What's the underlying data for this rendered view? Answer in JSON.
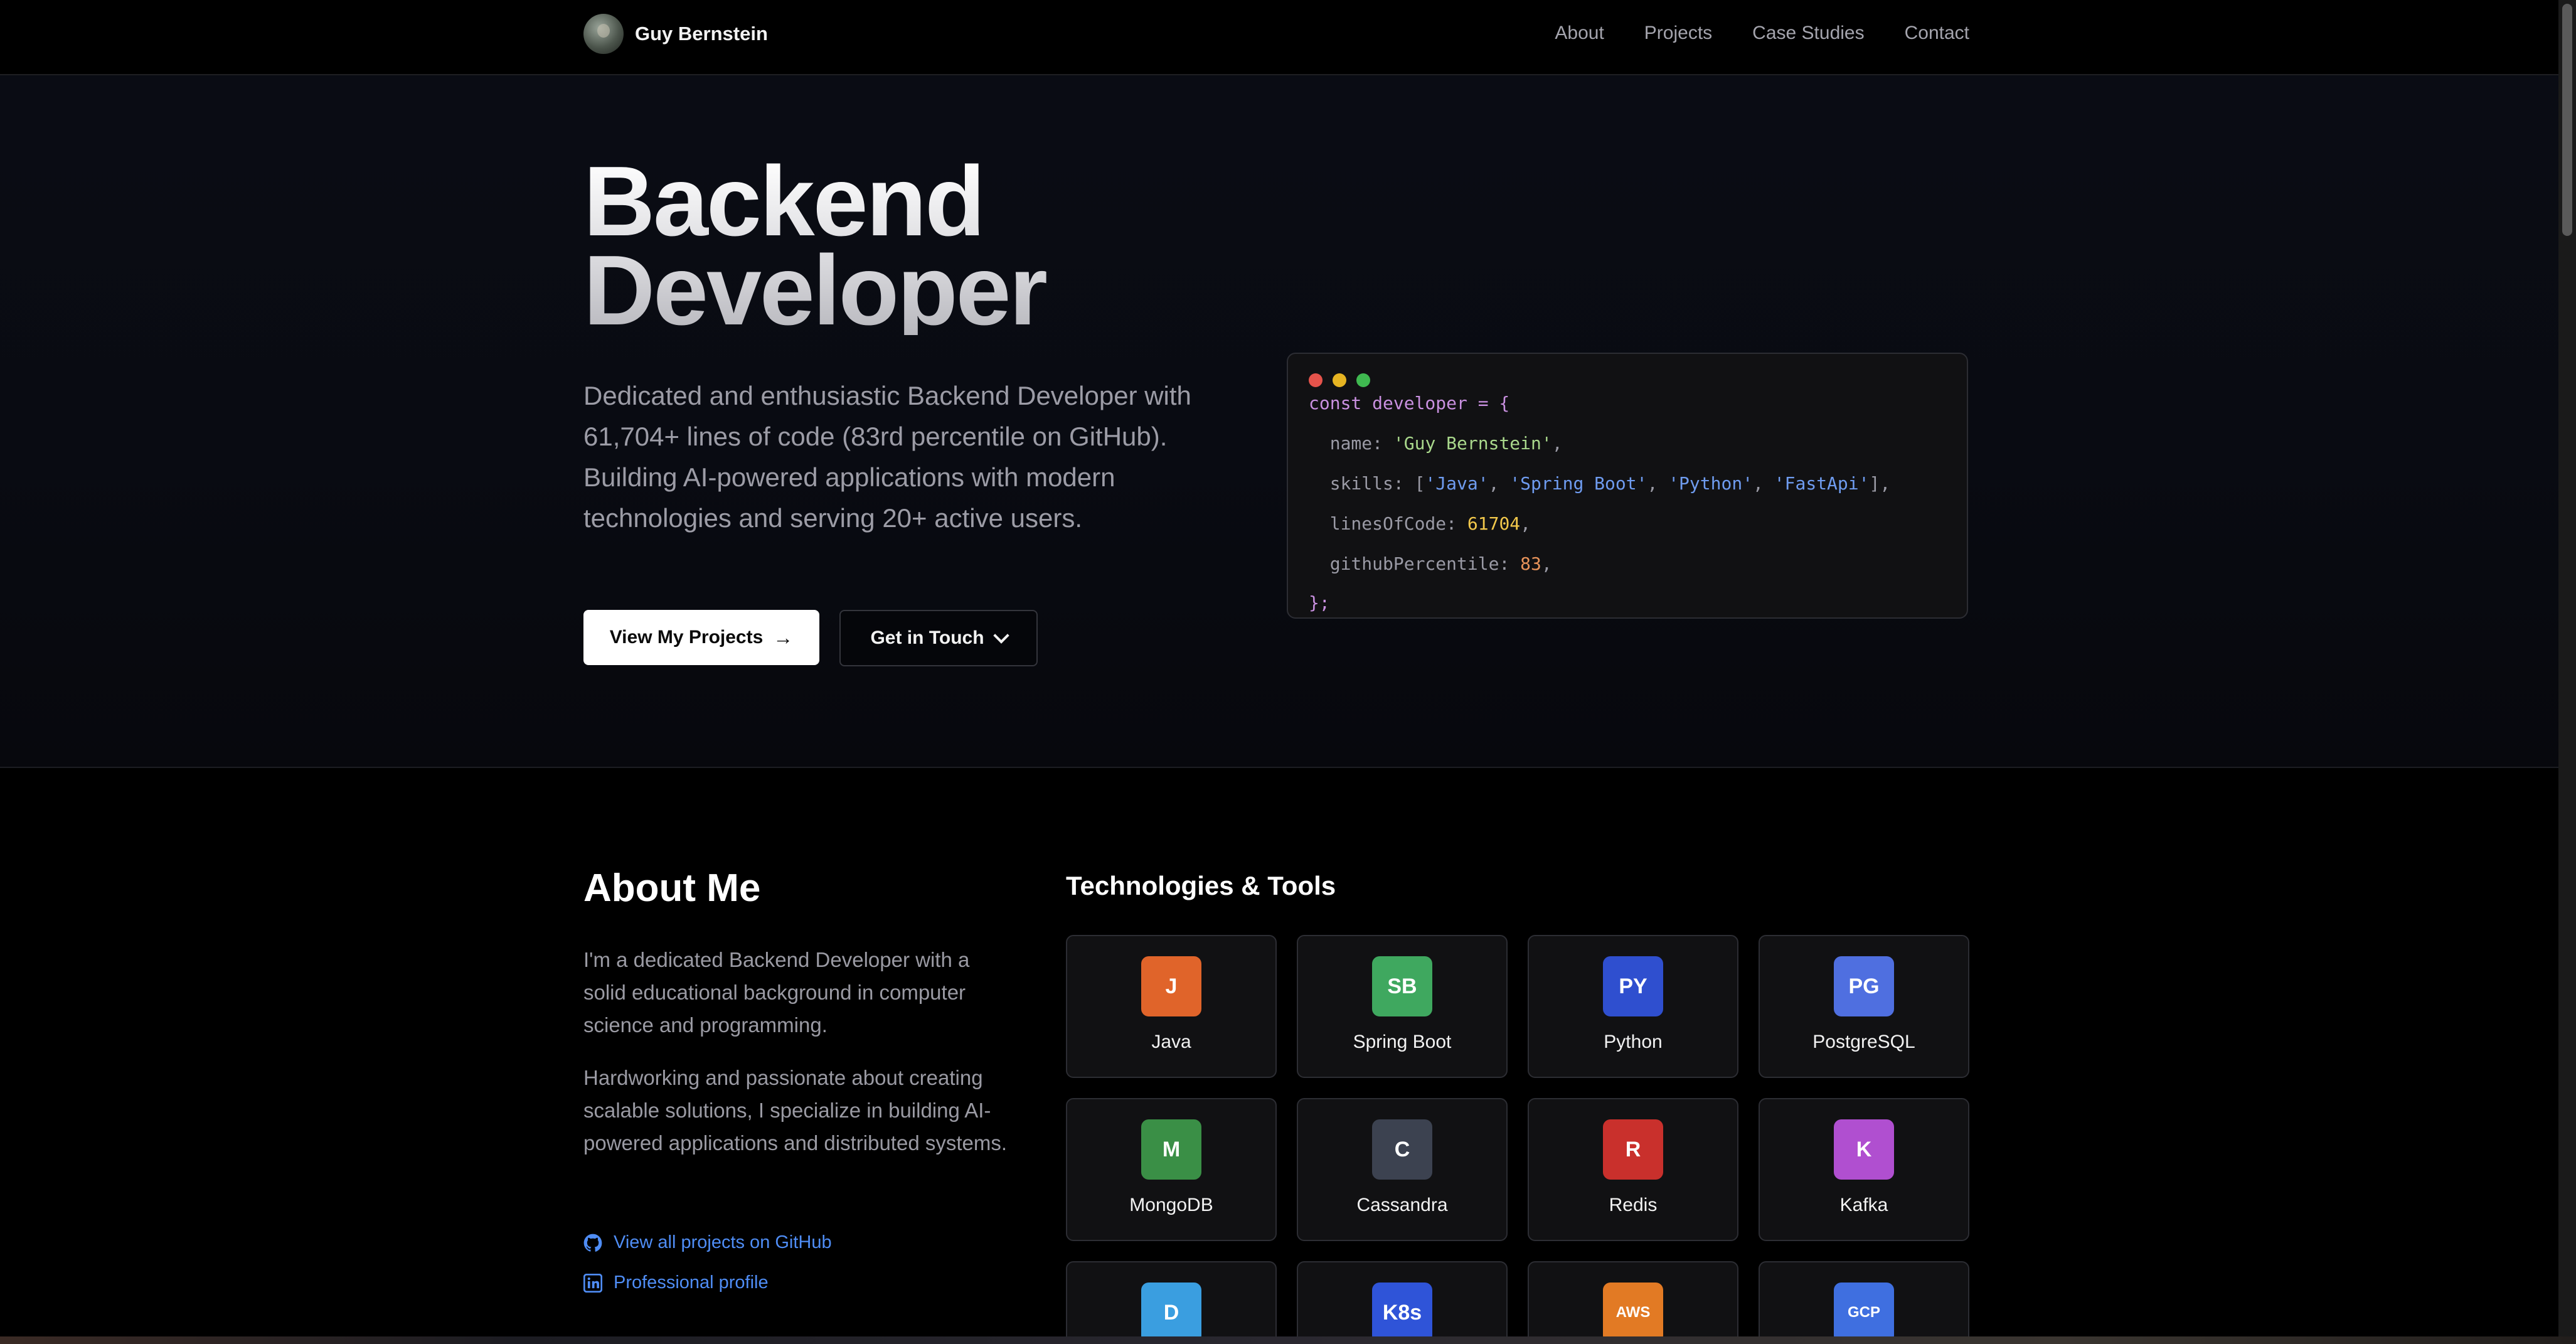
{
  "nav": {
    "brand": "Guy Bernstein",
    "links": [
      "About",
      "Projects",
      "Case Studies",
      "Contact"
    ]
  },
  "hero": {
    "title_line1": "Backend",
    "title_line2": "Developer",
    "description": "Dedicated and enthusiastic Backend Developer with 61,704+ lines of code (83rd percentile on GitHub). Building AI-powered applications with modern technologies and serving 20+ active users.",
    "primary_button": "View My Projects",
    "primary_arrow": "→",
    "secondary_button": "Get in Touch"
  },
  "code": {
    "decl": "const developer = {",
    "name_key": "name: ",
    "name_val": "'Guy Bernstein'",
    "skills_key": "skills: [",
    "skills": [
      "'Java'",
      "'Spring Boot'",
      "'Python'",
      "'FastApi'"
    ],
    "skills_end": "],",
    "loc_key": "linesOfCode: ",
    "loc_val": "61704",
    "pct_key": "githubPercentile: ",
    "pct_val": "83",
    "comma": ",",
    "sep": ", ",
    "close": "};",
    "dot_colors": [
      "#e5534b",
      "#e6b422",
      "#3fb950"
    ]
  },
  "about": {
    "title": "About Me",
    "p1": "I'm a dedicated Backend Developer with a solid educational background in computer science and programming.",
    "p2": "Hardworking and passionate about creating scalable solutions, I specialize in building AI-powered applications and distributed systems.",
    "github_link": "View all projects on GitHub",
    "linkedin_link": "Professional profile"
  },
  "tech": {
    "title": "Technologies & Tools",
    "items": [
      {
        "badge": "J",
        "name": "Java",
        "color": "#e0642a"
      },
      {
        "badge": "SB",
        "name": "Spring Boot",
        "color": "#3fa85f"
      },
      {
        "badge": "PY",
        "name": "Python",
        "color": "#2f4fcf"
      },
      {
        "badge": "PG",
        "name": "PostgreSQL",
        "color": "#4f6fe0"
      },
      {
        "badge": "M",
        "name": "MongoDB",
        "color": "#3a8f46"
      },
      {
        "badge": "C",
        "name": "Cassandra",
        "color": "#3c4250"
      },
      {
        "badge": "R",
        "name": "Redis",
        "color": "#c9302c"
      },
      {
        "badge": "K",
        "name": "Kafka",
        "color": "#b04fd0"
      },
      {
        "badge": "D",
        "name": "",
        "color": "#3a9ee0"
      },
      {
        "badge": "K8s",
        "name": "",
        "color": "#2f54d8"
      },
      {
        "badge": "AWS",
        "name": "",
        "color": "#e27a24"
      },
      {
        "badge": "GCP",
        "name": "",
        "color": "#3f6fe0"
      }
    ]
  }
}
